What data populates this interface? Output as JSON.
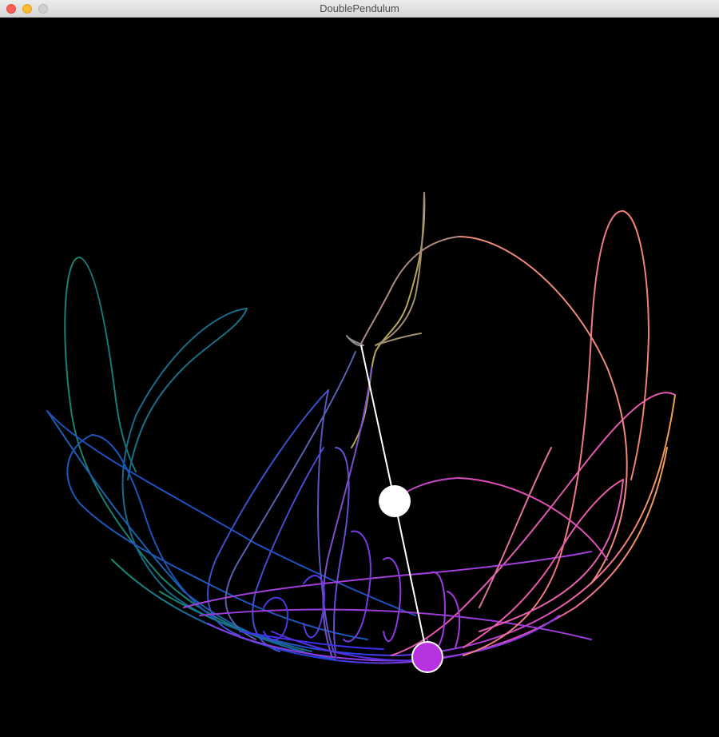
{
  "window": {
    "title": "DoublePendulum",
    "controls": [
      "close",
      "minimize",
      "zoom"
    ]
  },
  "colors": {
    "background": "#000000",
    "rod": "#ffffff",
    "bob1": "#ffffff",
    "bob2": "#b833e0",
    "bob2_stroke": "#ffffff",
    "trail_palette": [
      "#c2b03a",
      "#a08a6a",
      "#8a8a8a",
      "#1a8a6a",
      "#1860b0",
      "#2a3ae8",
      "#6a2ae0",
      "#b03ae0",
      "#e24ab8",
      "#f07a8a",
      "#f0a050"
    ]
  },
  "icons": {
    "close": "traffic-light-close-icon",
    "minimize": "traffic-light-minimize-icon",
    "zoom": "traffic-light-zoom-icon"
  }
}
